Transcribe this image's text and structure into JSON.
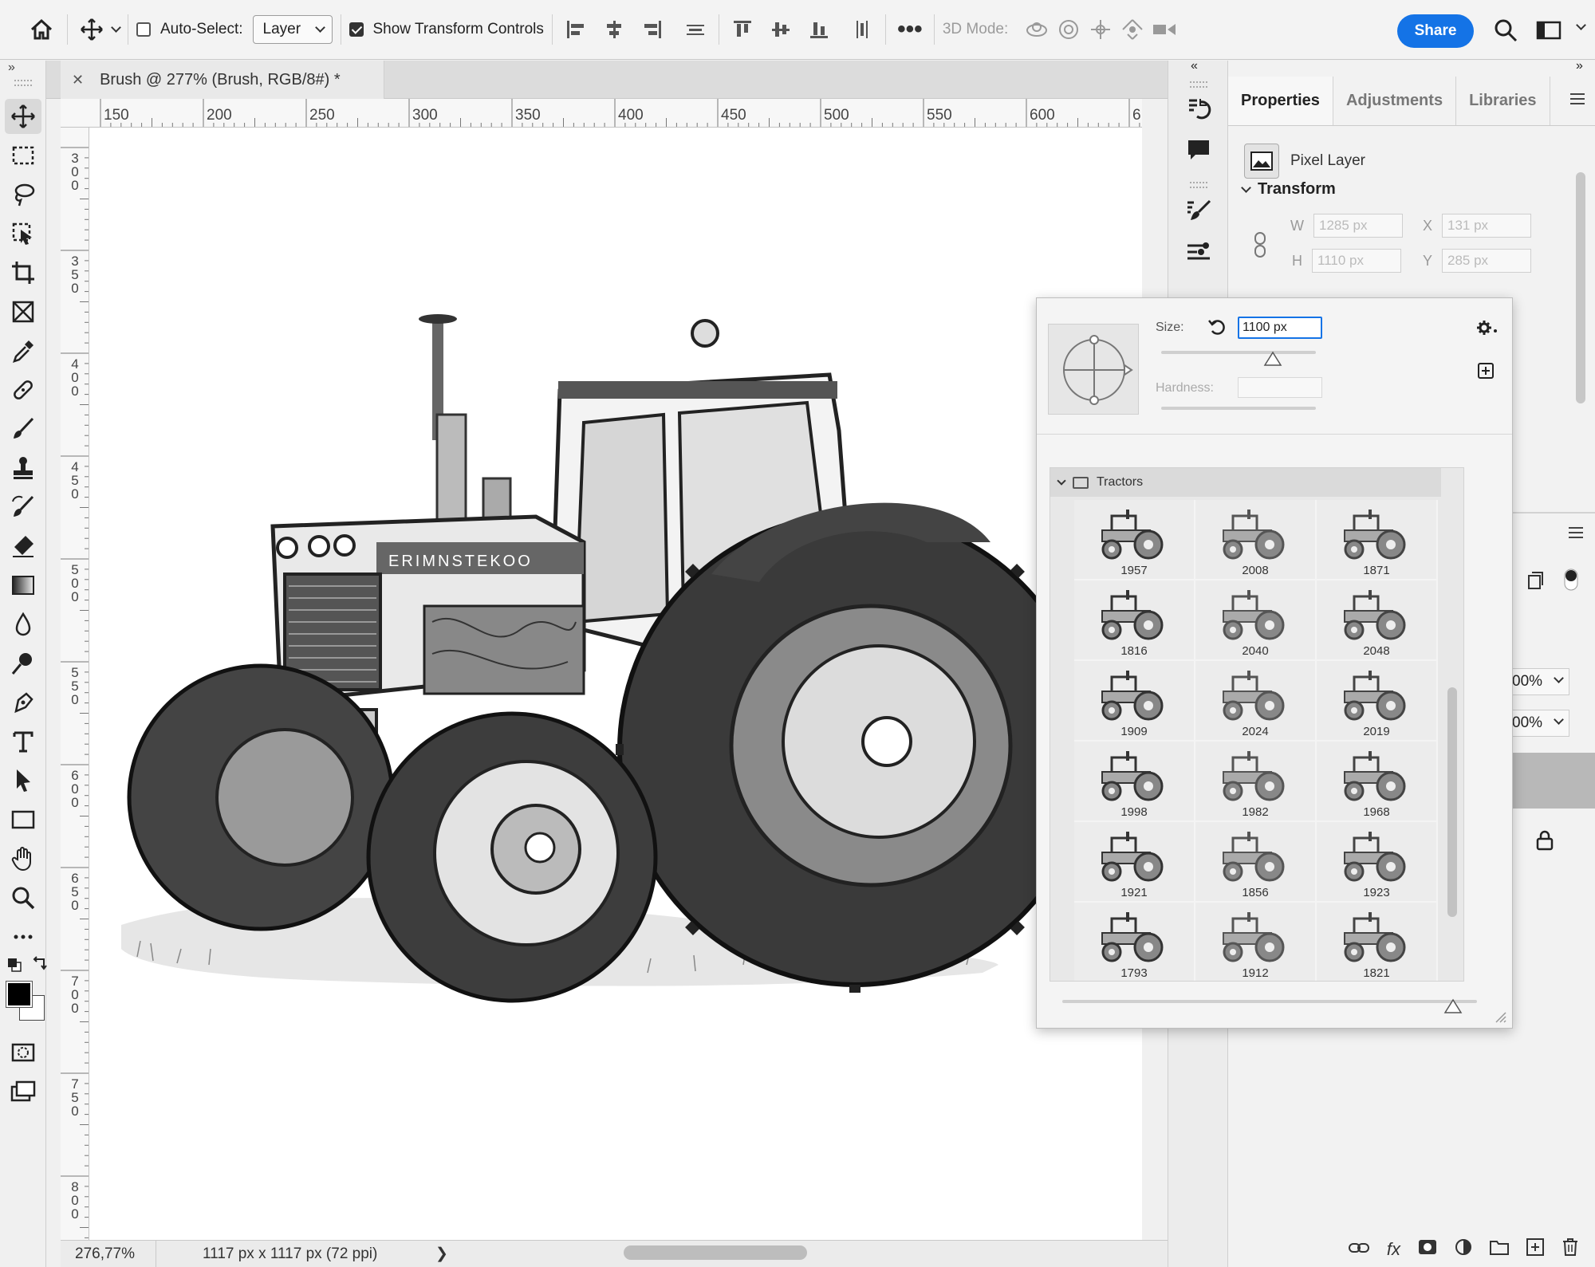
{
  "options_bar": {
    "auto_select_label": "Auto-Select:",
    "auto_select_value": "Layer",
    "show_transform_label": "Show Transform Controls",
    "mode_3d_label": "3D Mode:",
    "share_label": "Share"
  },
  "document": {
    "tab_title": "Brush @ 277% (Brush, RGB/8#) *",
    "zoom": "276,77%",
    "doc_size": "1117 px x 1117 px (72 ppi)"
  },
  "ruler": {
    "h_labels": [
      "150",
      "200",
      "250",
      "300",
      "350",
      "400",
      "450",
      "500",
      "550",
      "600",
      "6"
    ],
    "v_labels": [
      "300",
      "350",
      "400",
      "450",
      "500",
      "550",
      "600",
      "650",
      "700",
      "750",
      "800"
    ]
  },
  "properties": {
    "tabs": [
      "Properties",
      "Adjustments",
      "Libraries"
    ],
    "layer_type": "Pixel Layer",
    "section_title": "Transform",
    "w_label": "W",
    "w_value": "1285 px",
    "h_label": "H",
    "h_value": "1110 px",
    "x_label": "X",
    "x_value": "131 px",
    "y_label": "Y",
    "y_value": "285 px",
    "opacity_1": "00%",
    "opacity_2": "00%"
  },
  "brush_picker": {
    "size_label": "Size:",
    "size_value": "1100 px",
    "hardness_label": "Hardness:",
    "size_slider_fraction": 0.72,
    "group_name": "Tractors",
    "brushes": [
      "1957",
      "2008",
      "1871",
      "1816",
      "2040",
      "2048",
      "1909",
      "2024",
      "2019",
      "1998",
      "1982",
      "1968",
      "1921",
      "1856",
      "1923",
      "1793",
      "1912",
      "1821"
    ]
  }
}
